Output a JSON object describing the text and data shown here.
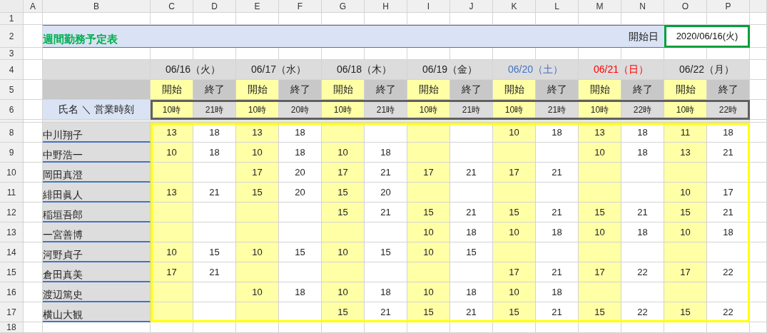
{
  "column_headers": [
    "A",
    "B",
    "C",
    "D",
    "E",
    "F",
    "G",
    "H",
    "I",
    "J",
    "K",
    "L",
    "M",
    "N",
    "O",
    "P"
  ],
  "row_headers": [
    "1",
    "2",
    "3",
    "4",
    "5",
    "6",
    "8",
    "9",
    "10",
    "11",
    "12",
    "13",
    "14",
    "15",
    "16",
    "17",
    "18"
  ],
  "title": "週間勤務予定表",
  "start_label": "開始日",
  "start_date": "2020/06/16(火)",
  "corner_label": "氏名 ＼ 営業時刻",
  "days": [
    {
      "label": "06/16（火）",
      "kind": "weekday",
      "start_label": "開始",
      "end_label": "終了",
      "open": "10時",
      "close": "21時"
    },
    {
      "label": "06/17（水）",
      "kind": "weekday",
      "start_label": "開始",
      "end_label": "終了",
      "open": "10時",
      "close": "20時"
    },
    {
      "label": "06/18（木）",
      "kind": "weekday",
      "start_label": "開始",
      "end_label": "終了",
      "open": "10時",
      "close": "21時"
    },
    {
      "label": "06/19（金）",
      "kind": "weekday",
      "start_label": "開始",
      "end_label": "終了",
      "open": "10時",
      "close": "21時"
    },
    {
      "label": "06/20（土）",
      "kind": "saturday",
      "start_label": "開始",
      "end_label": "終了",
      "open": "10時",
      "close": "21時"
    },
    {
      "label": "06/21（日）",
      "kind": "sunday",
      "start_label": "開始",
      "end_label": "終了",
      "open": "10時",
      "close": "22時"
    },
    {
      "label": "06/22（月）",
      "kind": "weekday",
      "start_label": "開始",
      "end_label": "終了",
      "open": "10時",
      "close": "22時"
    }
  ],
  "staff": [
    {
      "name": "中川翔子",
      "cells": {
        "C": "13",
        "D": "18",
        "E": "13",
        "F": "18",
        "K": "10",
        "L": "18",
        "M": "13",
        "N": "18",
        "O": "11",
        "P": "18"
      }
    },
    {
      "name": "中野浩一",
      "cells": {
        "C": "10",
        "D": "18",
        "E": "10",
        "F": "18",
        "G": "10",
        "H": "18",
        "M": "10",
        "N": "18",
        "O": "13",
        "P": "21"
      }
    },
    {
      "name": "岡田真澄",
      "cells": {
        "E": "17",
        "F": "20",
        "G": "17",
        "H": "21",
        "I": "17",
        "J": "21",
        "K": "17",
        "L": "21"
      }
    },
    {
      "name": "緋田眞人",
      "cells": {
        "C": "13",
        "D": "21",
        "E": "15",
        "F": "20",
        "G": "15",
        "H": "20",
        "O": "10",
        "P": "17"
      }
    },
    {
      "name": "稲垣吾郎",
      "cells": {
        "G": "15",
        "H": "21",
        "I": "15",
        "J": "21",
        "K": "15",
        "L": "21",
        "M": "15",
        "N": "21",
        "O": "15",
        "P": "21"
      }
    },
    {
      "name": "一宮善博",
      "cells": {
        "I": "10",
        "J": "18",
        "K": "10",
        "L": "18",
        "M": "10",
        "N": "18",
        "O": "10",
        "P": "18"
      }
    },
    {
      "name": "河野貞子",
      "cells": {
        "C": "10",
        "D": "15",
        "E": "10",
        "F": "15",
        "G": "10",
        "H": "15",
        "I": "10",
        "J": "15"
      }
    },
    {
      "name": "倉田真美",
      "cells": {
        "C": "17",
        "D": "21",
        "K": "17",
        "L": "21",
        "M": "17",
        "N": "22",
        "O": "17",
        "P": "22"
      }
    },
    {
      "name": "渡辺篤史",
      "cells": {
        "E": "10",
        "F": "18",
        "G": "10",
        "H": "18",
        "I": "10",
        "J": "18",
        "K": "10",
        "L": "18"
      }
    },
    {
      "name": "横山大観",
      "cells": {
        "G": "15",
        "H": "21",
        "I": "15",
        "J": "21",
        "K": "15",
        "L": "21",
        "M": "15",
        "N": "22",
        "O": "15",
        "P": "22"
      }
    }
  ]
}
